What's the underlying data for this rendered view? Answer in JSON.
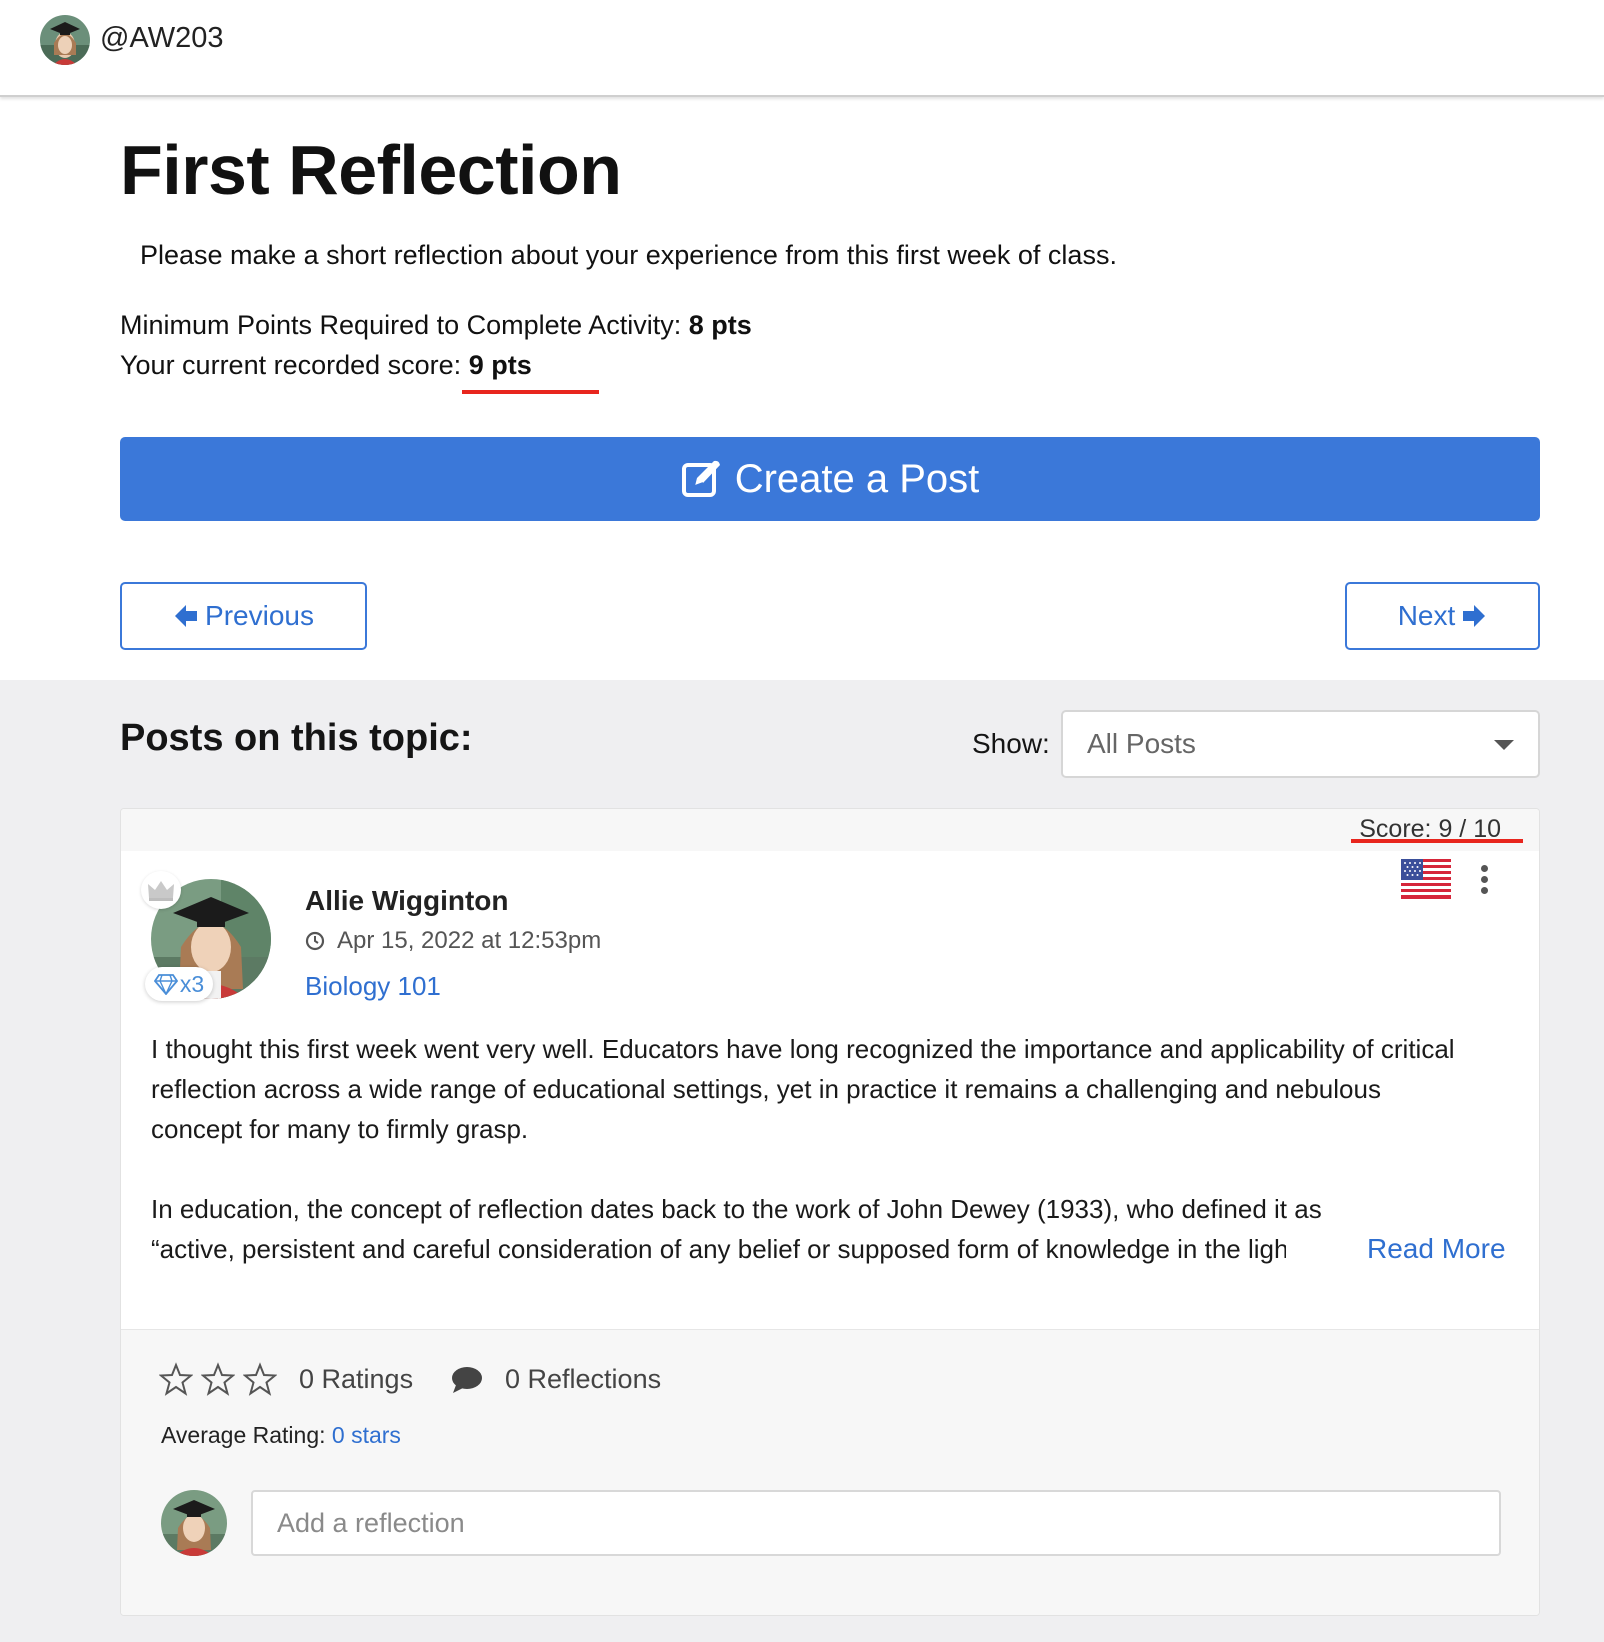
{
  "user": {
    "handle": "@AW203"
  },
  "activity": {
    "title": "First Reflection",
    "prompt": "Please make a short reflection about your experience from this first week of class.",
    "min_points_label": "Minimum Points Required to Complete Activity: ",
    "min_points_value": "8 pts",
    "score_label": "Your current recorded score: ",
    "score_value": "9 pts"
  },
  "actions": {
    "create_post": "Create a Post",
    "previous": "Previous",
    "next": "Next"
  },
  "posts_section": {
    "heading": "Posts on this topic:",
    "show_label": "Show:",
    "show_selected": "All Posts"
  },
  "post": {
    "score": "Score: 9 / 10",
    "author": "Allie Wigginton",
    "timestamp": "Apr 15, 2022 at 12:53pm",
    "course": "Biology 101",
    "gem_count": "x3",
    "body_p1": "I thought this first week went very well. Educators have long recognized the importance and applicability of critical reflection across a wide range of educational settings, yet in practice it remains a challenging and nebulous concept for many to firmly grasp.",
    "body_p2_line1": "In education, the concept of reflection dates back to the work of John Dewey (1933), who defined it as",
    "body_p2_line2": "“active, persistent and careful consideration of any belief or supposed form of knowledge in the light of",
    "read_more": "Read More",
    "ratings": "0 Ratings",
    "reflections": "0 Reflections",
    "avg_rating_label": "Average Rating: ",
    "avg_rating_value": "0 stars",
    "reply_placeholder": "Add a reflection",
    "star_count": 3,
    "star_rating": 0
  },
  "colors": {
    "accent": "#3b78d9",
    "link": "#2f6fd0",
    "highlight": "#e8261e",
    "section_bg": "#efeff1"
  },
  "icons": [
    "avatar-photo",
    "edit-icon",
    "arrow-left-icon",
    "arrow-right-icon",
    "chevron-down-icon",
    "crown-icon",
    "gem-icon",
    "clock-icon",
    "us-flag-icon",
    "kebab-menu-icon",
    "star-icon",
    "comment-icon"
  ]
}
